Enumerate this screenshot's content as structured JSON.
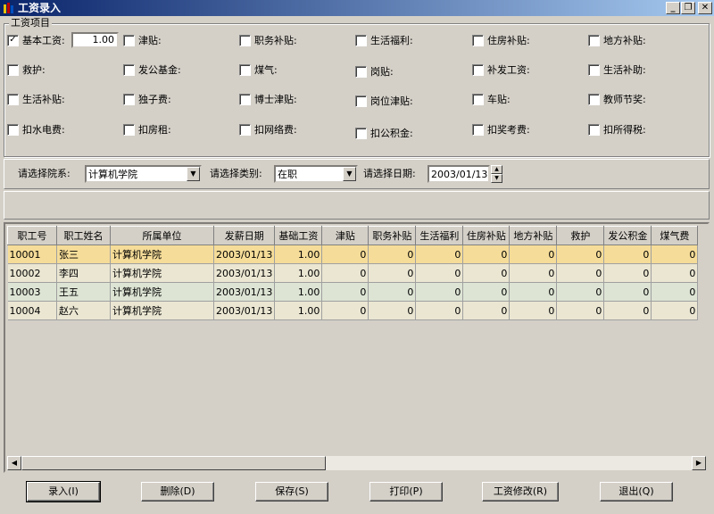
{
  "window": {
    "title": "工资录入"
  },
  "group": {
    "title": "工资项目"
  },
  "base_value": "1.00",
  "items": [
    {
      "label": "基本工资:",
      "checked": true
    },
    {
      "label": "津贴:",
      "checked": false
    },
    {
      "label": "职务补贴:",
      "checked": false
    },
    {
      "label": "生活福利:",
      "checked": false
    },
    {
      "label": "住房补贴:",
      "checked": false
    },
    {
      "label": "地方补贴:",
      "checked": false
    },
    {
      "label": "救护:",
      "checked": false
    },
    {
      "label": "发公基金:",
      "checked": false
    },
    {
      "label": "煤气:",
      "checked": false
    },
    {
      "label": "岗贴:",
      "checked": false
    },
    {
      "label": "补发工资:",
      "checked": false
    },
    {
      "label": "生活补助:",
      "checked": false
    },
    {
      "label": "生活补贴:",
      "checked": false
    },
    {
      "label": "独子费:",
      "checked": false
    },
    {
      "label": "博士津贴:",
      "checked": false
    },
    {
      "label": "岗位津贴:",
      "checked": false
    },
    {
      "label": "车贴:",
      "checked": false
    },
    {
      "label": "教师节奖:",
      "checked": false
    },
    {
      "label": "扣水电费:",
      "checked": false
    },
    {
      "label": "扣房租:",
      "checked": false
    },
    {
      "label": "扣网络费:",
      "checked": false
    },
    {
      "label": "扣公积金:",
      "checked": false
    },
    {
      "label": "扣奖考费:",
      "checked": false
    },
    {
      "label": "扣所得税:",
      "checked": false
    }
  ],
  "filters": {
    "dept_label": "请选择院系:",
    "dept_value": "计算机学院",
    "type_label": "请选择类别:",
    "type_value": "在职",
    "date_label": "请选择日期:",
    "date_value": "2003/01/13"
  },
  "table": {
    "columns": [
      "职工号",
      "职工姓名",
      "所属单位",
      "发薪日期",
      "基础工资",
      "津贴",
      "职务补贴",
      "生活福利",
      "住房补贴",
      "地方补贴",
      "救护",
      "发公积金",
      "煤气费"
    ],
    "rows": [
      [
        "10001",
        "张三",
        "计算机学院",
        "2003/01/13",
        "1.00",
        "0",
        "0",
        "0",
        "0",
        "0",
        "0",
        "0",
        "0"
      ],
      [
        "10002",
        "李四",
        "计算机学院",
        "2003/01/13",
        "1.00",
        "0",
        "0",
        "0",
        "0",
        "0",
        "0",
        "0",
        "0"
      ],
      [
        "10003",
        "王五",
        "计算机学院",
        "2003/01/13",
        "1.00",
        "0",
        "0",
        "0",
        "0",
        "0",
        "0",
        "0",
        "0"
      ],
      [
        "10004",
        "赵六",
        "计算机学院",
        "2003/01/13",
        "1.00",
        "0",
        "0",
        "0",
        "0",
        "0",
        "0",
        "0",
        "0"
      ]
    ]
  },
  "buttons": {
    "enter": "录入(I)",
    "delete": "删除(D)",
    "save": "保存(S)",
    "print": "打印(P)",
    "modify": "工资修改(R)",
    "exit": "退出(Q)"
  },
  "colors": {
    "selected_row": "#f5dc98",
    "row": "#eae6d2",
    "row_alt": "#dde4d4"
  }
}
